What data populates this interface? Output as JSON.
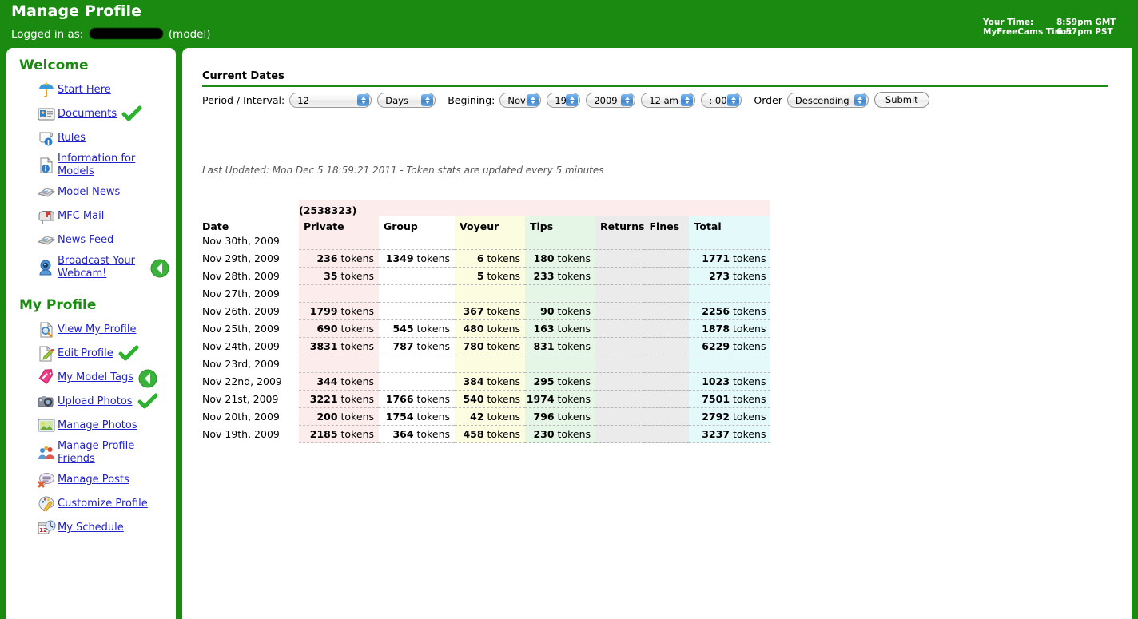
{
  "header": {
    "title": "Manage Profile",
    "logged_in_prefix": "Logged in as:",
    "logged_in_suffix": "(model)",
    "your_time_label": "Your Time:",
    "your_time_value": "8:59pm GMT",
    "mfc_time_label": "MyFreeCams Time:",
    "mfc_time_value": "6:57pm PST",
    "bg_color": "#1a8a11"
  },
  "sidebar": {
    "section1_title": "Welcome",
    "section1_items": [
      {
        "label": "Start Here",
        "icon": "umbrella-icon",
        "mark": ""
      },
      {
        "label": "Documents",
        "icon": "id-card-icon",
        "mark": "check"
      },
      {
        "label": "Rules",
        "icon": "scroll-info-icon",
        "mark": ""
      },
      {
        "label": "Information for Models",
        "icon": "info-page-icon",
        "mark": ""
      },
      {
        "label": "Model News",
        "icon": "newspaper-icon",
        "mark": ""
      },
      {
        "label": "MFC Mail",
        "icon": "mailbox-icon",
        "mark": ""
      },
      {
        "label": "News Feed",
        "icon": "newspaper-icon",
        "mark": ""
      },
      {
        "label": "Broadcast Your Webcam!",
        "icon": "webcam-icon",
        "mark": "arrow-left"
      }
    ],
    "section2_title": "My Profile",
    "section2_items": [
      {
        "label": "View My Profile",
        "icon": "page-magnifier-icon",
        "mark": ""
      },
      {
        "label": "Edit Profile",
        "icon": "page-pencil-icon",
        "mark": "check"
      },
      {
        "label": "My Model Tags",
        "icon": "tag-icon",
        "mark": "arrow-left"
      },
      {
        "label": "Upload Photos",
        "icon": "camera-icon",
        "mark": "check"
      },
      {
        "label": "Manage Photos",
        "icon": "picture-icon",
        "mark": ""
      },
      {
        "label": "Manage Profile Friends",
        "icon": "people-icon",
        "mark": ""
      },
      {
        "label": "Manage Posts",
        "icon": "comment-delete-icon",
        "mark": ""
      },
      {
        "label": "Customize Profile",
        "icon": "palette-icon",
        "mark": ""
      },
      {
        "label": "My Schedule",
        "icon": "calendar-clock-icon",
        "mark": ""
      }
    ]
  },
  "main": {
    "section_title": "Current Dates",
    "form": {
      "period_label": "Period / Interval:",
      "period_value": "12",
      "unit_value": "Days",
      "beginning_label": "Begining:",
      "month_value": "Nov",
      "day_value": "19",
      "year_value": "2009",
      "hour_value": "12 am",
      "minute_value": ": 00",
      "order_label": "Order",
      "order_value": "Descending",
      "submit_label": "Submit"
    },
    "last_updated": "Last Updated: Mon Dec 5 18:59:21 2011 - Token stats are updated every 5 minutes",
    "token_count": "(2538323)",
    "table": {
      "columns": [
        "Date",
        "Private",
        "Group",
        "Voyeur",
        "Tips",
        "Returns",
        "Fines",
        "Total"
      ],
      "unit": "tokens",
      "rows": [
        {
          "date": "Nov 30th, 2009",
          "private": "",
          "group": "",
          "voyeur": "",
          "tips": "",
          "returns": "",
          "fines": "",
          "total": ""
        },
        {
          "date": "Nov 29th, 2009",
          "private": "236",
          "group": "1349",
          "voyeur": "6",
          "tips": "180",
          "returns": "",
          "fines": "",
          "total": "1771"
        },
        {
          "date": "Nov 28th, 2009",
          "private": "35",
          "group": "",
          "voyeur": "5",
          "tips": "233",
          "returns": "",
          "fines": "",
          "total": "273"
        },
        {
          "date": "Nov 27th, 2009",
          "private": "",
          "group": "",
          "voyeur": "",
          "tips": "",
          "returns": "",
          "fines": "",
          "total": ""
        },
        {
          "date": "Nov 26th, 2009",
          "private": "1799",
          "group": "",
          "voyeur": "367",
          "tips": "90",
          "returns": "",
          "fines": "",
          "total": "2256"
        },
        {
          "date": "Nov 25th, 2009",
          "private": "690",
          "group": "545",
          "voyeur": "480",
          "tips": "163",
          "returns": "",
          "fines": "",
          "total": "1878"
        },
        {
          "date": "Nov 24th, 2009",
          "private": "3831",
          "group": "787",
          "voyeur": "780",
          "tips": "831",
          "returns": "",
          "fines": "",
          "total": "6229"
        },
        {
          "date": "Nov 23rd, 2009",
          "private": "",
          "group": "",
          "voyeur": "",
          "tips": "",
          "returns": "",
          "fines": "",
          "total": ""
        },
        {
          "date": "Nov 22nd, 2009",
          "private": "344",
          "group": "",
          "voyeur": "384",
          "tips": "295",
          "returns": "",
          "fines": "",
          "total": "1023"
        },
        {
          "date": "Nov 21st, 2009",
          "private": "3221",
          "group": "1766",
          "voyeur": "540",
          "tips": "1974",
          "returns": "",
          "fines": "",
          "total": "7501"
        },
        {
          "date": "Nov 20th, 2009",
          "private": "200",
          "group": "1754",
          "voyeur": "42",
          "tips": "796",
          "returns": "",
          "fines": "",
          "total": "2792"
        },
        {
          "date": "Nov 19th, 2009",
          "private": "2185",
          "group": "364",
          "voyeur": "458",
          "tips": "230",
          "returns": "",
          "fines": "",
          "total": "3237"
        }
      ]
    }
  }
}
